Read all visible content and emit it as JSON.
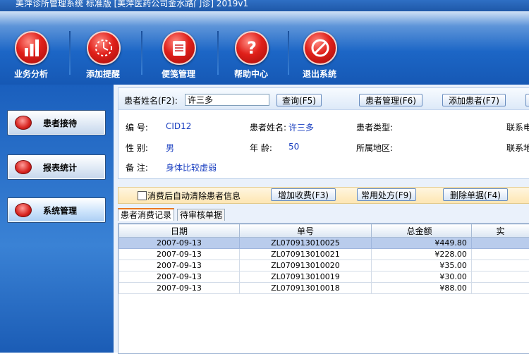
{
  "window": {
    "title": "美萍诊所管理系统 标准版 [美萍医药公司金水路门诊]   2019v1"
  },
  "toolbar": {
    "items": [
      {
        "label": "业务分析",
        "icon": "bar-chart-icon"
      },
      {
        "label": "添加提醒",
        "icon": "clock-icon"
      },
      {
        "label": "便笺管理",
        "icon": "notepad-icon"
      },
      {
        "label": "帮助中心",
        "icon": "question-icon"
      },
      {
        "label": "退出系统",
        "icon": "prohibit-icon"
      }
    ]
  },
  "sidebar": {
    "items": [
      {
        "label": "患者接待"
      },
      {
        "label": "报表统计"
      },
      {
        "label": "系统管理",
        "active": true
      }
    ]
  },
  "search": {
    "label": "患者姓名(F2):",
    "value": "许三多",
    "query_button": "查询(F5)",
    "manage_button": "患者管理(F6)",
    "add_button": "添加患者(F7)"
  },
  "patient": {
    "id_label": "编    号:",
    "id": "CID12",
    "name_label": "患者姓名:",
    "name": "许三多",
    "type_label": "患者类型:",
    "type": "",
    "contact_label": "联系电",
    "gender_label": "性    别:",
    "gender": "男",
    "age_label": "年    龄:",
    "age": "50",
    "region_label": "所属地区:",
    "region": "",
    "address_label": "联系地",
    "note_label": "备    注:",
    "note": "身体比较虚弱"
  },
  "actions": {
    "auto_clear_label": "消费后自动清除患者信息",
    "add_charge": "增加收费(F3)",
    "common_rx": "常用处方(F9)",
    "delete": "删除单据(F4)"
  },
  "tabs": [
    "患者消费记录",
    "待审核单据"
  ],
  "table": {
    "headers": [
      "日期",
      "单号",
      "总金额",
      "实"
    ],
    "rows": [
      {
        "date": "2007-09-13",
        "no": "ZL070913010025",
        "amount": "¥449.80",
        "selected": true
      },
      {
        "date": "2007-09-13",
        "no": "ZL070913010021",
        "amount": "¥228.00"
      },
      {
        "date": "2007-09-13",
        "no": "ZL070913010020",
        "amount": "¥35.00"
      },
      {
        "date": "2007-09-13",
        "no": "ZL070913010019",
        "amount": "¥30.00"
      },
      {
        "date": "2007-09-13",
        "no": "ZL070913010018",
        "amount": "¥88.00"
      }
    ]
  },
  "colors": {
    "toolbar_blue": "#1c66c6",
    "accent_red": "#e0201a",
    "selection": "#b9ccec"
  }
}
